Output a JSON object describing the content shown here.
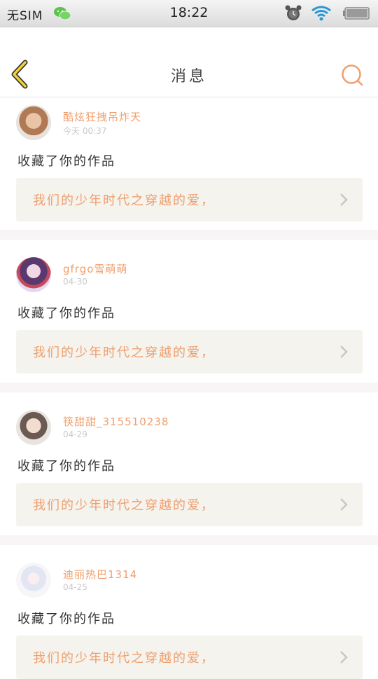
{
  "status_bar": {
    "carrier": "无SIM",
    "time": "18:22",
    "icons": [
      "wechat-icon",
      "alarm-icon",
      "wifi-icon",
      "battery-icon"
    ]
  },
  "header": {
    "title": "消息",
    "back_icon": "back-chevron-icon",
    "search_icon": "search-icon"
  },
  "colors": {
    "accent": "#ef9f6e",
    "back_yellow": "#f2d23a",
    "card_bg": "#f4f3ee",
    "separator": "#f7f5f5"
  },
  "messages": [
    {
      "username": "酷炫狂拽吊炸天",
      "time": "今天 00:37",
      "action": "收藏了你的作品",
      "work_title": "我们的少年时代之穿越的爱，"
    },
    {
      "username": "gfrgo雪萌萌",
      "time": "04-30",
      "action": "收藏了你的作品",
      "work_title": "我们的少年时代之穿越的爱，"
    },
    {
      "username": "筷甜甜_315510238",
      "time": "04-29",
      "action": "收藏了你的作品",
      "work_title": "我们的少年时代之穿越的爱，"
    },
    {
      "username": "迪丽热巴1314",
      "time": "04-25",
      "action": "收藏了你的作品",
      "work_title": "我们的少年时代之穿越的爱，"
    }
  ]
}
